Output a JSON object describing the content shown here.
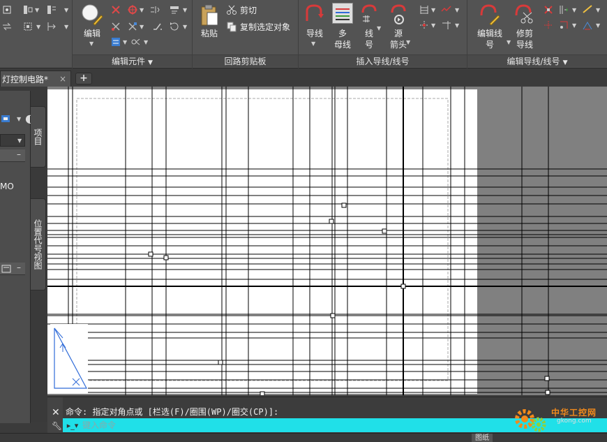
{
  "ribbon": {
    "edit_button": "编辑",
    "panel_edit_components": "编辑元件",
    "paste_button": "粘贴",
    "cut_button": "剪切",
    "copy_clip_button": "复制选定对象",
    "panel_circuit_clipboard": "回路剪贴板",
    "wire_button": "导线",
    "multi_bus_button_l1": "多",
    "multi_bus_button_l2": "母线",
    "wire_number_button_l1": "线",
    "wire_number_button_l2": "号",
    "source_arrow_button_l1": "源",
    "source_arrow_button_l2": "箭头",
    "panel_insert_wires": "插入导线/线号",
    "edit_wire_number_l1": "编辑线",
    "edit_wire_number_l2": "号",
    "trim_wire_l1": "修剪",
    "trim_wire_l2": "导线",
    "panel_edit_wires": "编辑导线/线号"
  },
  "tabs": {
    "document_tab": "灯控制电路*",
    "close_symbol": "×",
    "new_tab_symbol": "+"
  },
  "palette": {
    "project_tab": "项目",
    "location_tab": "位置代号视图",
    "tree_fragment": "MO"
  },
  "command": {
    "history": "命令: 指定对角点或 [栏选(F)/圈围(WP)/圈交(CP)]:",
    "placeholder": "键入命令"
  },
  "statusbar": {
    "layout_tab": "图纸"
  },
  "watermark": {
    "brand": "中华工控网",
    "domain": "gkong.com"
  },
  "colors": {
    "ribbon_bg": "#535353",
    "canvas_bg": "#808080",
    "paper_bg": "#ffffff",
    "command_input_bg": "#20e0e8",
    "accent_red": "#d83a3a",
    "accent_blue": "#2f6bd8"
  }
}
